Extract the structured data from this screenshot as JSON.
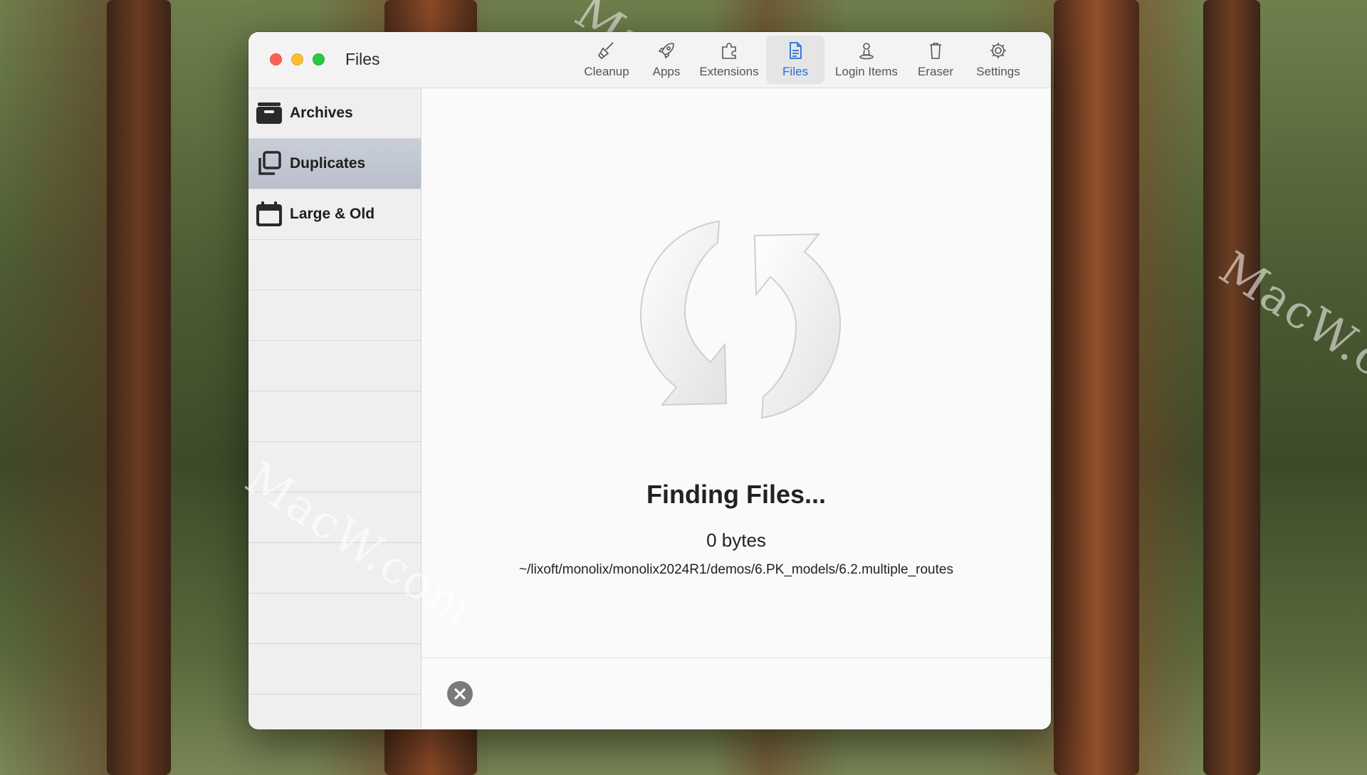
{
  "window": {
    "title": "Files"
  },
  "toolbar": {
    "items": [
      {
        "label": "Cleanup",
        "icon": "broom-icon",
        "active": false
      },
      {
        "label": "Apps",
        "icon": "rocket-icon",
        "active": false
      },
      {
        "label": "Extensions",
        "icon": "puzzle-icon",
        "active": false
      },
      {
        "label": "Files",
        "icon": "document-icon",
        "active": true
      },
      {
        "label": "Login Items",
        "icon": "person-icon",
        "active": false
      },
      {
        "label": "Eraser",
        "icon": "trash-icon",
        "active": false
      },
      {
        "label": "Settings",
        "icon": "gear-icon",
        "active": false
      }
    ]
  },
  "sidebar": {
    "items": [
      {
        "label": "Archives",
        "icon": "archive-box-icon",
        "selected": false
      },
      {
        "label": "Duplicates",
        "icon": "duplicate-icon",
        "selected": true
      },
      {
        "label": "Large & Old",
        "icon": "calendar-icon",
        "selected": false
      }
    ]
  },
  "main": {
    "status_title": "Finding Files...",
    "size": "0 bytes",
    "current_path": "~/lixoft/monolix/monolix2024R1/demos/6.PK_models/6.2.multiple_routes"
  },
  "watermarks": [
    "MacW.com",
    "MacW.com",
    "MacW.c"
  ],
  "colors": {
    "accent": "#1f6fd6",
    "selected_row": "#c0c6d1"
  }
}
